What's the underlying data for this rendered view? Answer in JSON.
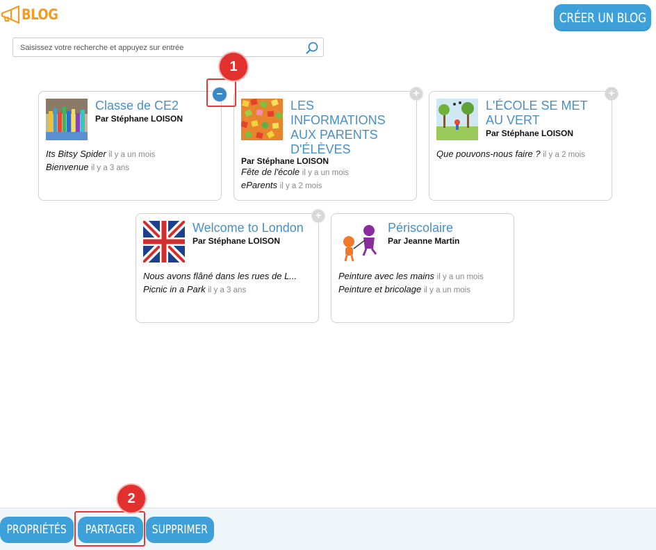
{
  "header": {
    "app_title": "BLOG",
    "create_label": "CRÉER UN BLOG"
  },
  "search": {
    "placeholder": "Saisissez votre recherche et appuyez sur entrée"
  },
  "blogs": [
    {
      "title": "Classe de CE2",
      "author": "Par Stéphane LOISON",
      "selected": true,
      "toggle": "−",
      "posts": [
        {
          "title": "Its Bitsy Spider",
          "ago": "il y a un mois"
        },
        {
          "title": "Bienvenue",
          "ago": "il y a 3 ans"
        }
      ]
    },
    {
      "title": "LES INFORMATIONS AUX PARENTS D'ÉLÈVES",
      "author": "Par Stéphane LOISON",
      "selected": false,
      "toggle": "+",
      "posts": [
        {
          "title": "Fête de l'école",
          "ago": "il y a un mois"
        },
        {
          "title": "eParents",
          "ago": "il y a 2 mois"
        }
      ]
    },
    {
      "title": "L'ÉCOLE SE MET AU VERT",
      "author": "Par Stéphane LOISON",
      "selected": false,
      "toggle": "+",
      "posts": [
        {
          "title": "Que pouvons-nous faire ?",
          "ago": "il y a 2 mois"
        }
      ]
    },
    {
      "title": "Welcome to London",
      "author": "Par Stéphane LOISON",
      "selected": false,
      "toggle": "+",
      "posts": [
        {
          "title": "Nous avons flâné dans les rues de L...",
          "ago": ""
        },
        {
          "title": "Picnic in a Park",
          "ago": "il y a 3 ans"
        }
      ]
    },
    {
      "title": "Périscolaire",
      "author": "Par Jeanne Martin",
      "selected": false,
      "toggle": "",
      "posts": [
        {
          "title": "Peinture avec les mains",
          "ago": "il y a un mois"
        },
        {
          "title": "Peinture et bricolage",
          "ago": "il y a un mois"
        }
      ]
    }
  ],
  "annotations": {
    "step1": "1",
    "step2": "2"
  },
  "toolbar": {
    "properties_label": "PROPRIÉTÉS",
    "share_label": "PARTAGER",
    "delete_label": "SUPPRIMER"
  },
  "colors": {
    "accent": "#3ea0d8",
    "brand_orange": "#f39c22",
    "title_blue": "#4a8fc4",
    "annotation_red": "#e2302f"
  }
}
